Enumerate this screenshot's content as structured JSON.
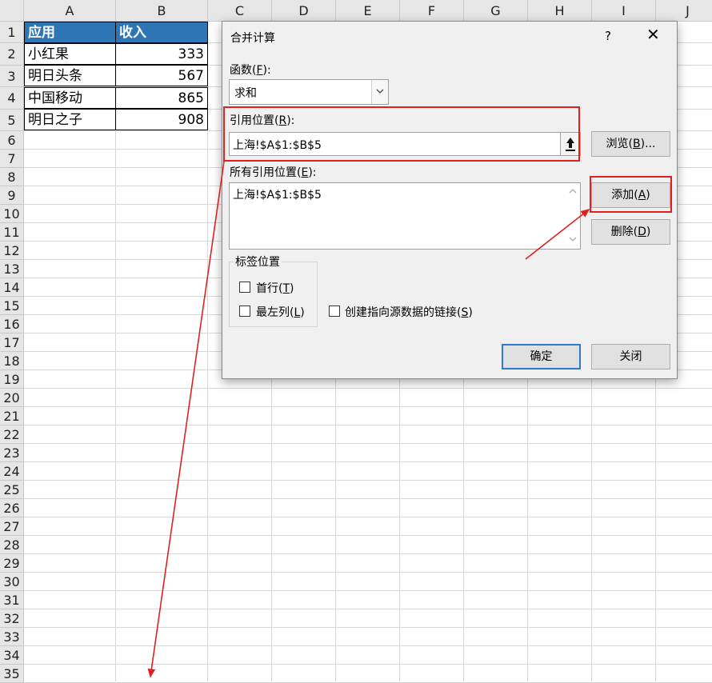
{
  "sheet": {
    "columns": [
      "A",
      "B",
      "C",
      "D",
      "E",
      "F",
      "G",
      "H",
      "I",
      "J"
    ],
    "rows": [
      "1",
      "2",
      "3",
      "4",
      "5",
      "6",
      "7",
      "8",
      "9",
      "10",
      "11",
      "12",
      "13",
      "14",
      "15",
      "16",
      "17",
      "18",
      "19",
      "20",
      "21",
      "22",
      "23",
      "24",
      "25",
      "26",
      "27",
      "28",
      "29",
      "30",
      "31",
      "32",
      "33",
      "34",
      "35"
    ],
    "header": {
      "a": "应用",
      "b": "收入"
    },
    "data": [
      {
        "app": "小红果",
        "income": "333"
      },
      {
        "app": "明日头条",
        "income": "567"
      },
      {
        "app": "中国移动",
        "income": "865"
      },
      {
        "app": "明日之子",
        "income": "908"
      }
    ]
  },
  "dialog": {
    "title": "合并计算",
    "help": "?",
    "close": "✕",
    "function_label": "函数(",
    "function_key": "F",
    "function_label_end": "):",
    "function_value": "求和",
    "ref_label": "引用位置(",
    "ref_key": "R",
    "ref_label_end": "):",
    "ref_value": "上海!$A$1:$B$5",
    "browse_label": "浏览(",
    "browse_key": "B",
    "browse_end": ")...",
    "all_refs_label": "所有引用位置(",
    "all_refs_key": "E",
    "all_refs_end": "):",
    "all_refs_items": [
      "上海!$A$1:$B$5"
    ],
    "add_label": "添加(",
    "add_key": "A",
    "add_end": ")",
    "delete_label": "删除(",
    "delete_key": "D",
    "delete_end": ")",
    "label_group": "标签位置",
    "first_row_label": "首行(",
    "first_row_key": "T",
    "first_row_end": ")",
    "left_col_label": "最左列(",
    "left_col_key": "L",
    "left_col_end": ")",
    "link_label": "创建指向源数据的链接(",
    "link_key": "S",
    "link_end": ")",
    "ok_label": "确定",
    "close_label": "关闭"
  },
  "colors": {
    "header_fill": "#2e75b6",
    "annotation": "#e02020",
    "primary_border": "#2f7ad1"
  }
}
